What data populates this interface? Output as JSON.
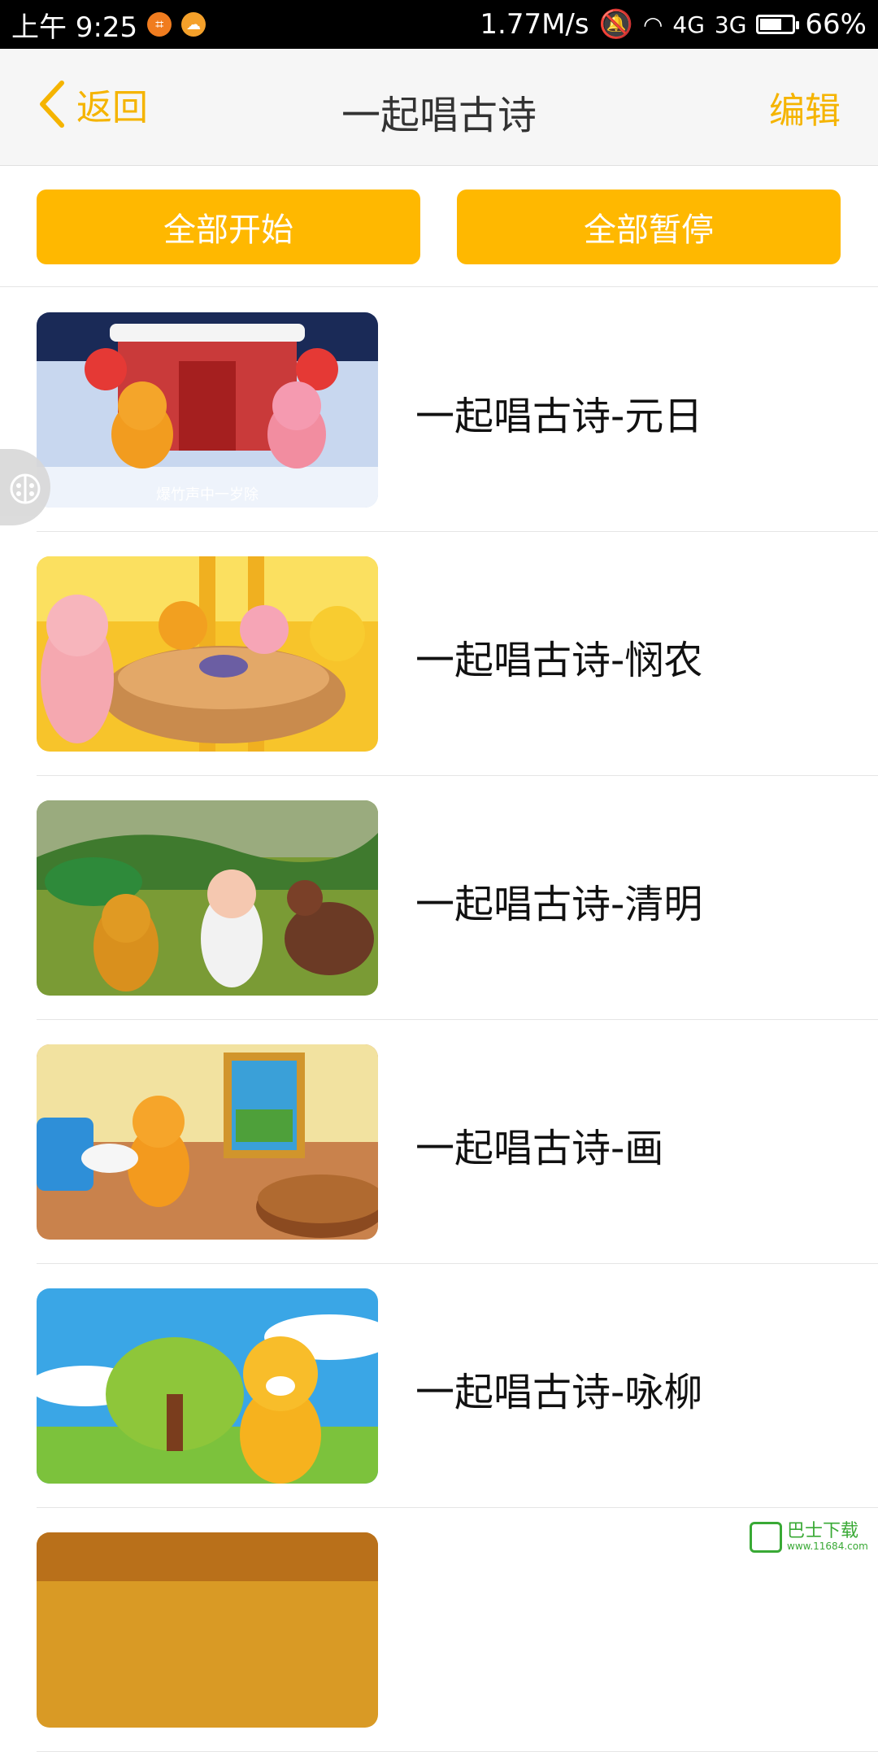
{
  "status_bar": {
    "time": "上午 9:25",
    "speed": "1.77M/s",
    "network1": "4G",
    "network2": "3G",
    "battery_text": "66%",
    "battery_level": 0.66
  },
  "nav": {
    "back_label": "返回",
    "title": "一起唱古诗",
    "edit_label": "编辑"
  },
  "actions": {
    "start_all": "全部开始",
    "pause_all": "全部暂停"
  },
  "items": [
    {
      "title": "一起唱古诗-元日",
      "caption": "爆竹声中一岁除"
    },
    {
      "title": "一起唱古诗-悯农"
    },
    {
      "title": "一起唱古诗-清明"
    },
    {
      "title": "一起唱古诗-画"
    },
    {
      "title": "一起唱古诗-咏柳"
    }
  ],
  "watermark": {
    "name": "巴士下载",
    "url": "www.11684.com"
  },
  "colors": {
    "accent": "#ffb800",
    "nav_text": "#f5b400"
  }
}
